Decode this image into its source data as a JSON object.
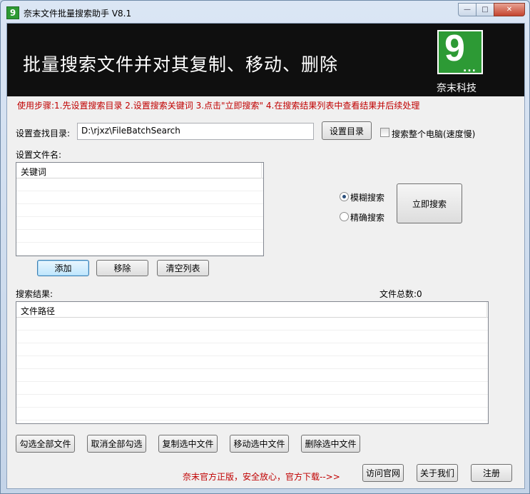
{
  "window": {
    "title": "奈末文件批量搜索助手 V8.1",
    "app_icon_glyph": "9",
    "controls": {
      "minimize": "—",
      "maximize": "□",
      "close": "✕"
    }
  },
  "banner": {
    "title": "批量搜索文件并对其复制、移动、删除",
    "logo_glyph": "9",
    "logo_dots": "...",
    "logo_caption": "奈末科技",
    "logo_color": "#2d9a35"
  },
  "steps_text": "使用步骤:1.先设置搜索目录 2.设置搜索关键词 3.点击\"立即搜索\" 4.在搜索结果列表中查看结果并后续处理",
  "directory": {
    "label": "设置查找目录:",
    "value": "D:\\rjxz\\FileBatchSearch",
    "set_button": "设置目录",
    "whole_pc_label": "搜索整个电脑(速度慢)",
    "whole_pc_checked": false
  },
  "filename": {
    "label": "设置文件名:",
    "column_header": "关键词",
    "rows": [],
    "add_button": "添加",
    "remove_button": "移除",
    "clear_button": "清空列表"
  },
  "search_mode": {
    "fuzzy_label": "模糊搜索",
    "exact_label": "精确搜索",
    "selected": "fuzzy",
    "search_button": "立即搜索"
  },
  "results": {
    "label": "搜索结果:",
    "total_label": "文件总数:",
    "total_value": "0",
    "column_header": "文件路径",
    "rows": []
  },
  "actions": {
    "check_all": "勾选全部文件",
    "uncheck_all": "取消全部勾选",
    "copy_selected": "复制选中文件",
    "move_selected": "移动选中文件",
    "delete_selected": "删除选中文件"
  },
  "footer": {
    "promo": "奈末官方正版，安全放心，官方下载-->>",
    "visit_site": "访问官网",
    "about_us": "关于我们",
    "register": "注册"
  },
  "colors": {
    "accent_red": "#c00000",
    "banner_bg": "#0f0f0f",
    "logo_green": "#2d9a35"
  }
}
